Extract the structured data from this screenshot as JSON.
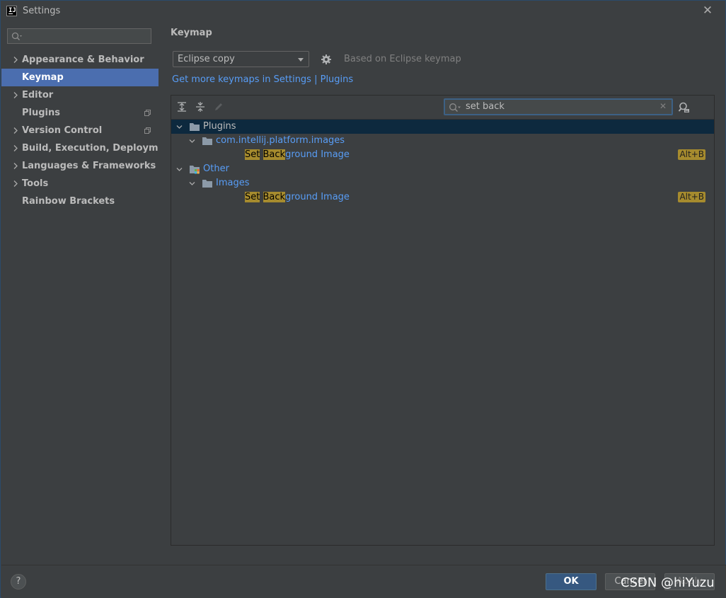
{
  "window": {
    "title": "Settings",
    "app_icon_text": "IJ"
  },
  "sidebar": {
    "search_placeholder": "",
    "items": [
      {
        "label": "Appearance & Behavior",
        "expandable": true,
        "selected": false,
        "project_icon": false
      },
      {
        "label": "Keymap",
        "expandable": false,
        "selected": true,
        "project_icon": false
      },
      {
        "label": "Editor",
        "expandable": true,
        "selected": false,
        "project_icon": false
      },
      {
        "label": "Plugins",
        "expandable": false,
        "selected": false,
        "project_icon": true
      },
      {
        "label": "Version Control",
        "expandable": true,
        "selected": false,
        "project_icon": true
      },
      {
        "label": "Build, Execution, Deployment",
        "expandable": true,
        "selected": false,
        "project_icon": false
      },
      {
        "label": "Languages & Frameworks",
        "expandable": true,
        "selected": false,
        "project_icon": false
      },
      {
        "label": "Tools",
        "expandable": true,
        "selected": false,
        "project_icon": false
      },
      {
        "label": "Rainbow Brackets",
        "expandable": false,
        "selected": false,
        "project_icon": false
      }
    ]
  },
  "main": {
    "title": "Keymap",
    "keymap_selected": "Eclipse copy",
    "based_on": "Based on Eclipse keymap",
    "more_keymaps_link": "Get more keymaps in Settings | Plugins",
    "filter": {
      "value": "set back"
    },
    "tree": [
      {
        "text": "Plugins",
        "level": 0,
        "expanded": true,
        "icon": "folder-icon",
        "selected": true,
        "color": "white"
      },
      {
        "text": "com.intellij.platform.images",
        "level": 1,
        "expanded": true,
        "icon": "folder-icon",
        "selected": false,
        "color": "blue"
      },
      {
        "text_match_1": "Set",
        "text_match_2": "Back",
        "text_rest": "ground Image",
        "level": 2,
        "action": true,
        "shortcut": "Alt+B"
      },
      {
        "text": "Other",
        "level": 0,
        "expanded": true,
        "icon": "other-group-icon",
        "selected": false,
        "color": "blue"
      },
      {
        "text": "Images",
        "level": 1,
        "expanded": true,
        "icon": "folder-icon",
        "selected": false,
        "color": "blue"
      },
      {
        "text_match_1": "Set",
        "text_match_2": "Back",
        "text_rest": "ground Image",
        "level": 2,
        "action": true,
        "shortcut": "Alt+B"
      }
    ]
  },
  "footer": {
    "help_label": "?",
    "ok_label": "OK",
    "cancel_label": "Cancel",
    "apply_label": "Apply",
    "watermark": "CSDN @hiYuzu"
  },
  "colors": {
    "background": "#3c3f41",
    "selection": "#4b6eaf",
    "tree_selection": "#0d293e",
    "link": "#589df6",
    "match_highlight": "#a68b2e",
    "ok_button": "#365880"
  }
}
